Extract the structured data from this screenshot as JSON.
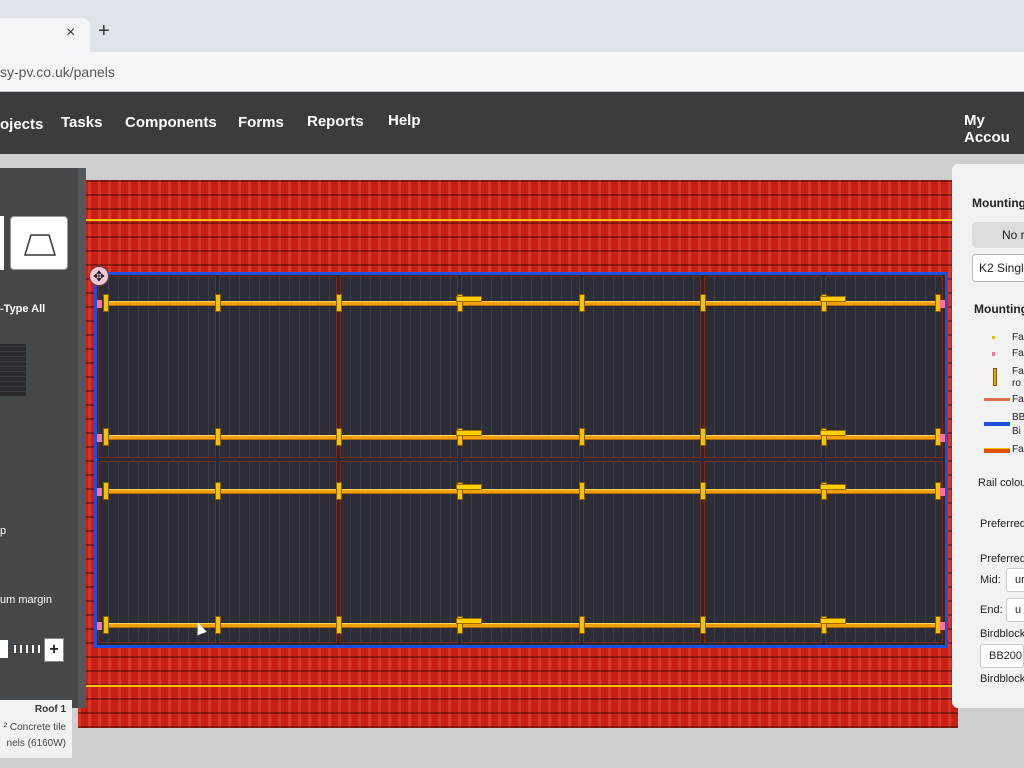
{
  "browser": {
    "tab_close": "×",
    "new_tab": "+",
    "url": "sy-pv.co.uk/panels"
  },
  "nav": {
    "items": [
      "ojects",
      "Tasks",
      "Components",
      "Forms",
      "Reports",
      "Help"
    ],
    "account": "My Accou"
  },
  "left_panel": {
    "type_all_label": "-Type All",
    "p_label": "p",
    "margin_label": "um margin",
    "plus_label": "+"
  },
  "right_panel": {
    "mounting_title": "Mounting",
    "no_button": "No r",
    "k2_select": "K2 Singl",
    "mounting2_title": "Mounting",
    "legend": [
      "Fa",
      "Fa",
      "Fa",
      "ro",
      "Fa",
      "BB",
      "Bi",
      "Fa"
    ],
    "rail_colour": "Rail colou",
    "preferred1": "Preferred",
    "preferred2": "Preferred",
    "mid_label": "Mid:",
    "mid_value": "ur",
    "end_label": "End:",
    "end_value": "u",
    "birdblock1": "Birdblock",
    "bb_value": "BB200",
    "birdblock2": "Birdblock"
  },
  "info_box": {
    "roof": "Roof 1",
    "tile": "² Concrete tile",
    "panels": "nels (6160W)"
  },
  "colors": {
    "roof": "#c81f16",
    "array_outline": "#1e4fe0",
    "rail": "#f2a00a",
    "nav_bg": "#3a3d40"
  }
}
